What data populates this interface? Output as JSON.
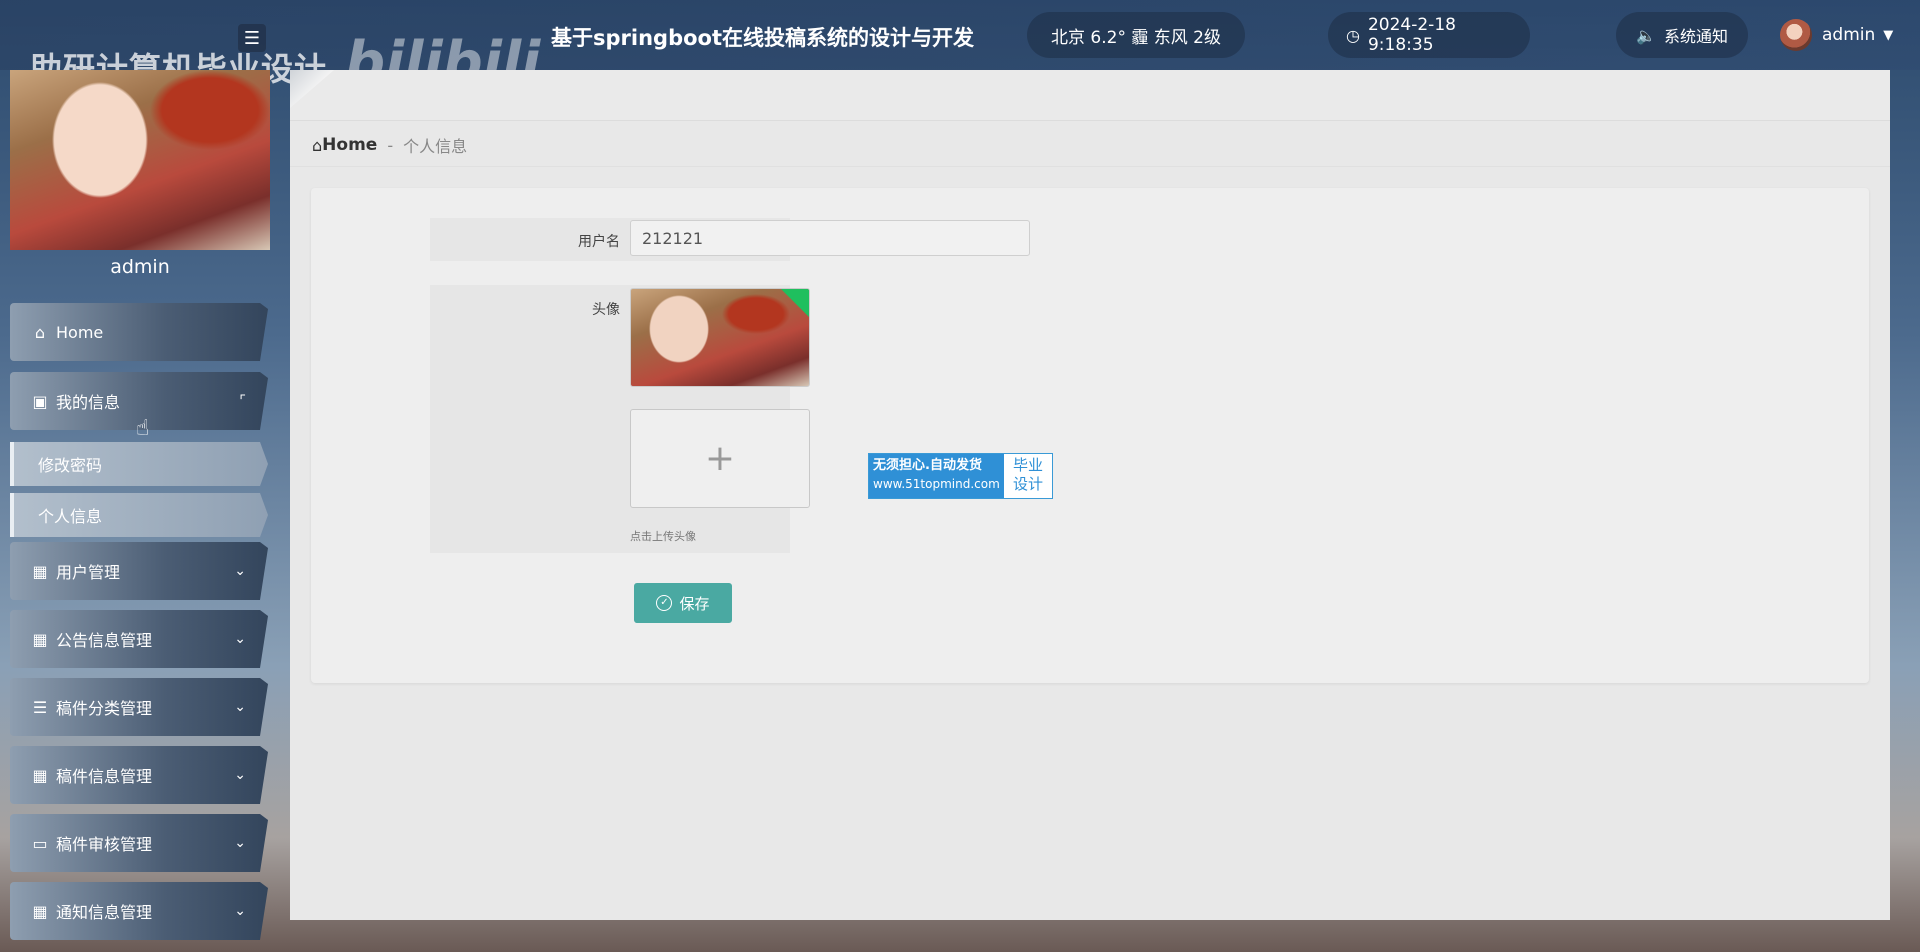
{
  "watermark": {
    "title": "助研计算机毕业设计",
    "logo": "bilibili"
  },
  "header": {
    "menu_icon": "menu-icon",
    "title": "基于springboot在线投稿系统的设计与开发",
    "weather": "北京  6.2°  霾  东风  2级",
    "datetime": "2024-2-18 9:18:35",
    "notice": "系统通知",
    "username": "admin"
  },
  "sidebar": {
    "username": "admin",
    "items": [
      {
        "label": "Home",
        "icon": "home-icon"
      },
      {
        "label": "我的信息",
        "icon": "wallet-icon",
        "expanded": true
      },
      {
        "label": "用户管理",
        "icon": "grid-icon"
      },
      {
        "label": "公告信息管理",
        "icon": "grid-icon"
      },
      {
        "label": "稿件分类管理",
        "icon": "sliders-icon"
      },
      {
        "label": "稿件信息管理",
        "icon": "grid-icon"
      },
      {
        "label": "稿件审核管理",
        "icon": "monitor-icon"
      },
      {
        "label": "通知信息管理",
        "icon": "grid-icon"
      }
    ],
    "sub_items": [
      {
        "label": "修改密码"
      },
      {
        "label": "个人信息",
        "active": true
      }
    ]
  },
  "breadcrumb": {
    "home": "Home",
    "separator": "-",
    "current": "个人信息"
  },
  "form": {
    "username_label": "用户名",
    "username_value": "212121",
    "avatar_label": "头像",
    "upload_hint": "点击上传头像",
    "save_label": "保存"
  },
  "ad_badge": {
    "line1": "无须担心.自动发货",
    "line2": "www.51topmind.com",
    "right": "毕业\n设计"
  },
  "colors": {
    "accent": "#4aa9a2",
    "badge": "#2f90d6"
  }
}
